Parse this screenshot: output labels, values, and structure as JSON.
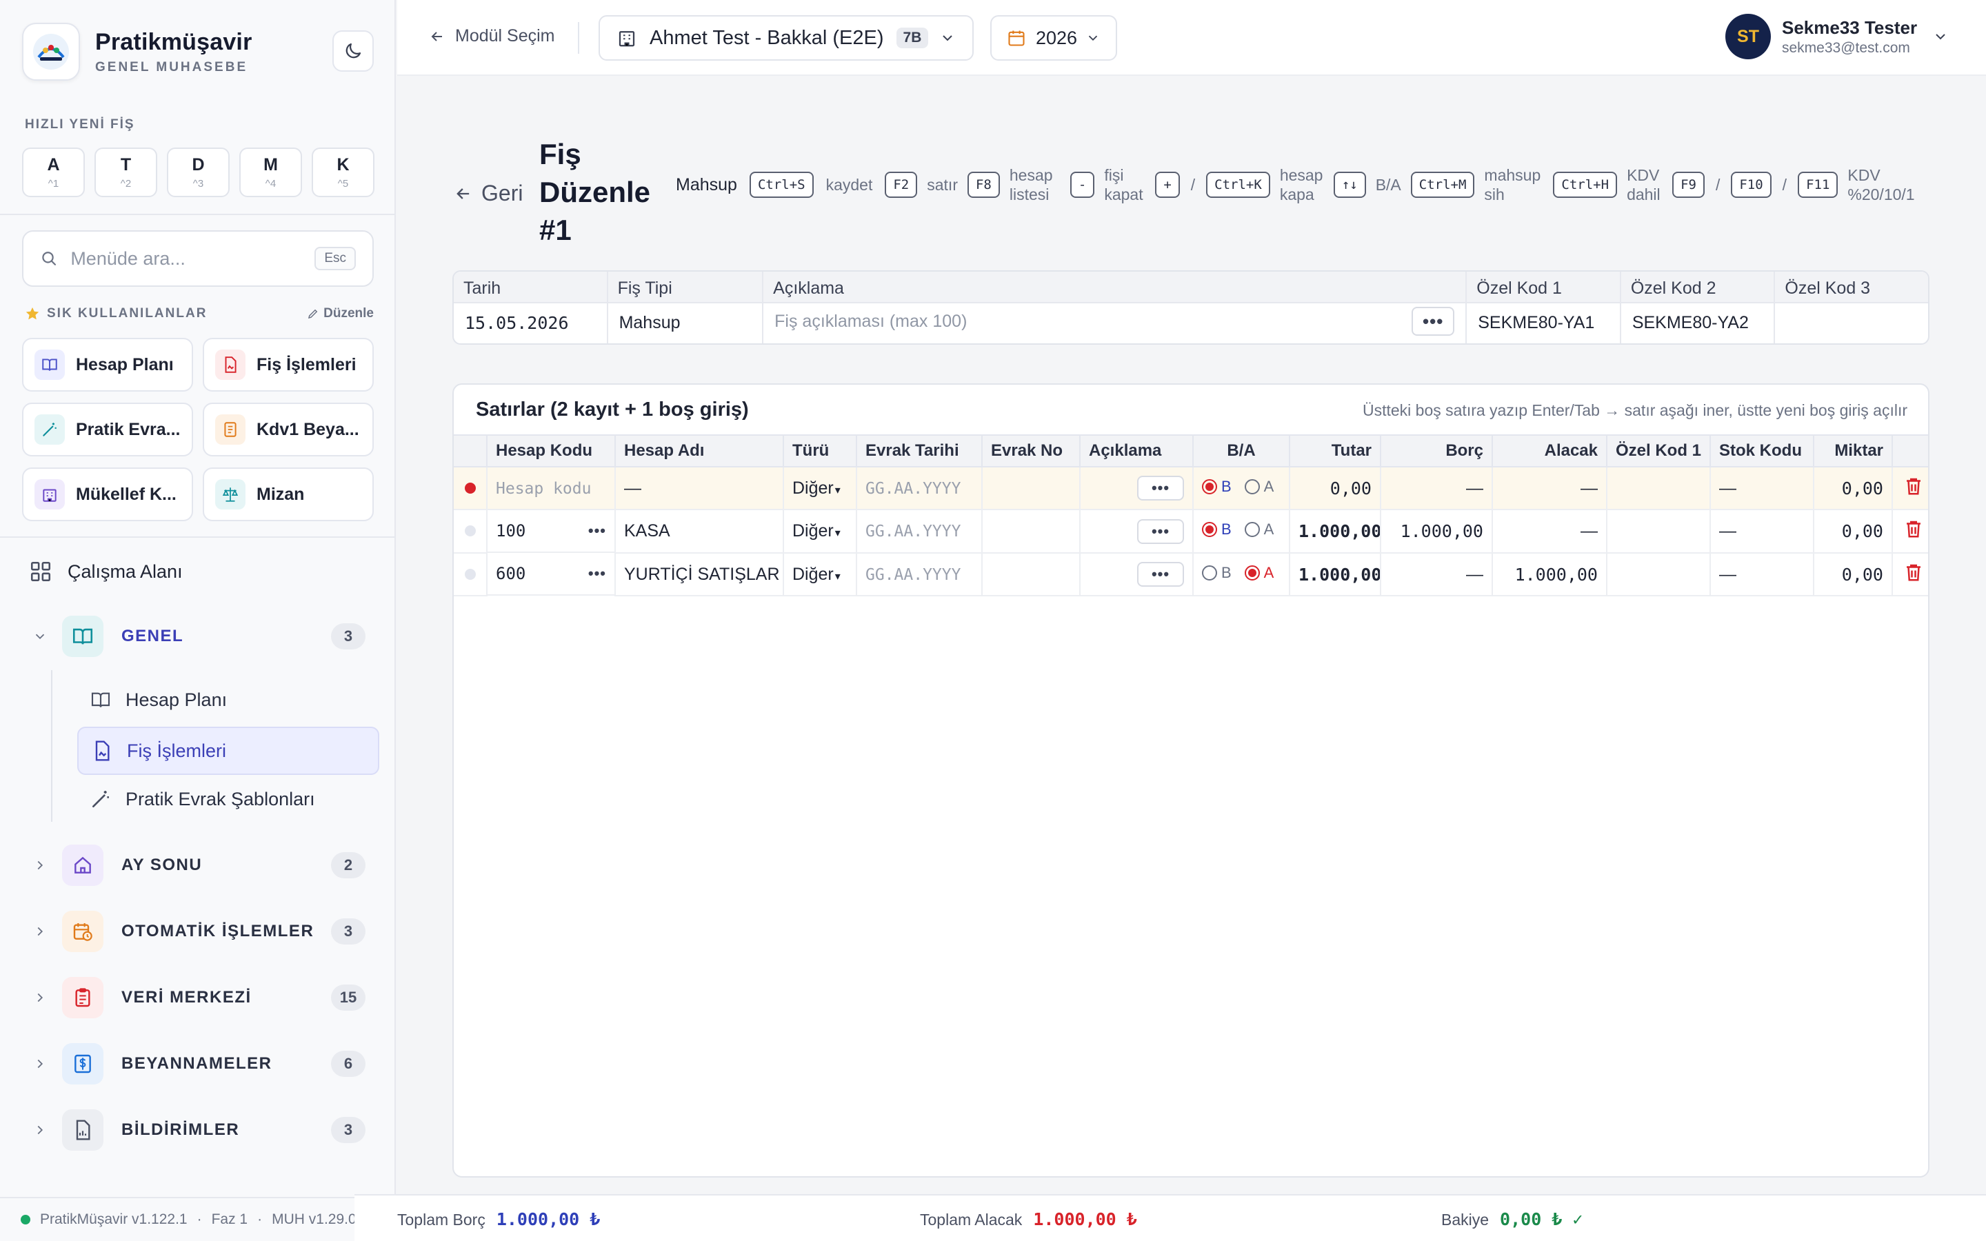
{
  "brand": {
    "name": "Pratikmüşavir",
    "subtitle": "GENEL MUHASEBE"
  },
  "quick": {
    "title": "HIZLI YENİ FİŞ",
    "buttons": [
      {
        "key": "A",
        "shortcut": "^1"
      },
      {
        "key": "T",
        "shortcut": "^2"
      },
      {
        "key": "D",
        "shortcut": "^3"
      },
      {
        "key": "M",
        "shortcut": "^4"
      },
      {
        "key": "K",
        "shortcut": "^5"
      }
    ]
  },
  "search": {
    "placeholder": "Menüde ara...",
    "esc": "Esc"
  },
  "favorites": {
    "title": "SIK KULLANILANLAR",
    "edit": "Düzenle",
    "items": [
      {
        "label": "Hesap Planı",
        "icon": "book-icon",
        "color": "#4b52c8"
      },
      {
        "label": "Fiş İşlemleri",
        "icon": "document-sign-icon",
        "color": "#d8232a"
      },
      {
        "label": "Pratik Evra...",
        "icon": "magic-wand-icon",
        "color": "#0f8f9b"
      },
      {
        "label": "Kdv1 Beya...",
        "icon": "receipt-icon",
        "color": "#e07a1a"
      },
      {
        "label": "Mükellef K...",
        "icon": "building-icon",
        "color": "#6b48c8"
      },
      {
        "label": "Mizan",
        "icon": "scale-icon",
        "color": "#0f8f9b"
      }
    ]
  },
  "nav": {
    "workspace": "Çalışma Alanı",
    "groups": [
      {
        "label": "GENEL",
        "count": "3",
        "expanded": true,
        "color": "#0f8f9b"
      },
      {
        "label": "AY SONU",
        "count": "2",
        "color": "#6b48c8"
      },
      {
        "label": "OTOMATİK İŞLEMLER",
        "count": "3",
        "color": "#e07a1a"
      },
      {
        "label": "VERİ MERKEZİ",
        "count": "15",
        "color": "#d8232a"
      },
      {
        "label": "BEYANNAMELER",
        "count": "6",
        "color": "#1a6fd8"
      },
      {
        "label": "BİLDİRİMLER",
        "count": "3",
        "color": "#4a5062"
      }
    ],
    "genel_items": [
      {
        "label": "Hesap Planı"
      },
      {
        "label": "Fiş İşlemleri",
        "active": true
      },
      {
        "label": "Pratik Evrak Şablonları"
      }
    ]
  },
  "sidebar_footer": {
    "app": "PratikMüşavir v1.122.1",
    "phase": "Faz 1",
    "module": "MUH v1.29.0"
  },
  "topbar": {
    "back": "Modül Seçim",
    "company": "Ahmet Test - Bakkal (E2E)",
    "company_badge": "7B",
    "year": "2026",
    "user_initials": "ST",
    "user_name": "Sekme33 Tester",
    "user_email": "sekme33@test.com"
  },
  "page": {
    "back": "Geri",
    "title": "Fiş Düzenle #1",
    "mode": "Mahsup",
    "shortcuts": [
      {
        "key": "Ctrl+S",
        "desc": "kaydet"
      },
      {
        "key": "F2",
        "desc": "satır"
      },
      {
        "key": "F8",
        "desc": "hesap listesi"
      },
      {
        "key": "-",
        "desc": "fişi kapat"
      },
      {
        "key": "+",
        "desc": "/"
      },
      {
        "key": "Ctrl+K",
        "desc": "hesap kapa"
      },
      {
        "key": "↑↓",
        "desc": "B/A"
      },
      {
        "key": "Ctrl+M",
        "desc": "mahsup sih"
      },
      {
        "key": "Ctrl+H",
        "desc": "KDV dahil"
      },
      {
        "key": "F9",
        "desc": "/"
      },
      {
        "key": "F10",
        "desc": "/"
      },
      {
        "key": "F11",
        "desc": "KDV %20/10/1"
      }
    ]
  },
  "header_fields": {
    "labels": [
      "Tarih",
      "Fiş Tipi",
      "Açıklama",
      "Özel Kod 1",
      "Özel Kod 2",
      "Özel Kod 3"
    ],
    "tarih": "15.05.2026",
    "fis_tipi": "Mahsup",
    "aciklama_placeholder": "Fiş açıklaması (max 100)",
    "ozel_kod_1": "SEKME80-YA1",
    "ozel_kod_2": "SEKME80-YA2",
    "ozel_kod_3": ""
  },
  "rows": {
    "title": "Satırlar (2 kayıt + 1 boş giriş)",
    "hint": "Üstteki boş satıra yazıp Enter/Tab → satır aşağı iner, üstte yeni boş giriş açılır",
    "columns": [
      "Hesap Kodu",
      "Hesap Adı",
      "Türü",
      "Evrak Tarihi",
      "Evrak No",
      "Açıklama",
      "B/A",
      "Tutar",
      "Borç",
      "Alacak",
      "Özel Kod 1",
      "Stok Kodu",
      "Miktar"
    ],
    "entry": {
      "hesap_kodu_placeholder": "Hesap kodu",
      "hesap_adi": "—",
      "turu": "Diğer",
      "evrak_tarihi_placeholder": "GG.AA.YYYY",
      "ba": "B",
      "tutar": "0,00",
      "borc": "—",
      "alacak": "—",
      "stok_kodu": "—",
      "miktar": "0,00"
    },
    "lines": [
      {
        "hesap_kodu": "100",
        "hesap_adi": "KASA",
        "turu": "Diğer",
        "evrak_tarihi": "GG.AA.YYYY",
        "ba": "B",
        "tutar": "1.000,00",
        "borc": "1.000,00",
        "alacak": "—",
        "stok_kodu": "—",
        "miktar": "0,00"
      },
      {
        "hesap_kodu": "600",
        "hesap_adi": "YURTİÇİ SATIŞLAR",
        "turu": "Diğer",
        "evrak_tarihi": "GG.AA.YYYY",
        "ba": "A",
        "tutar": "1.000,00",
        "borc": "—",
        "alacak": "1.000,00",
        "stok_kodu": "—",
        "miktar": "0,00"
      }
    ]
  },
  "totals": {
    "borc_label": "Toplam Borç",
    "borc": "1.000,00 ₺",
    "alacak_label": "Toplam Alacak",
    "alacak": "1.000,00 ₺",
    "bakiye_label": "Bakiye",
    "bakiye": "0,00 ₺ ✓"
  },
  "colors": {
    "accent": "#3b3fb6",
    "borc": "#2e3fb8",
    "alacak": "#d8232a",
    "balanced": "#1a8a4a"
  }
}
